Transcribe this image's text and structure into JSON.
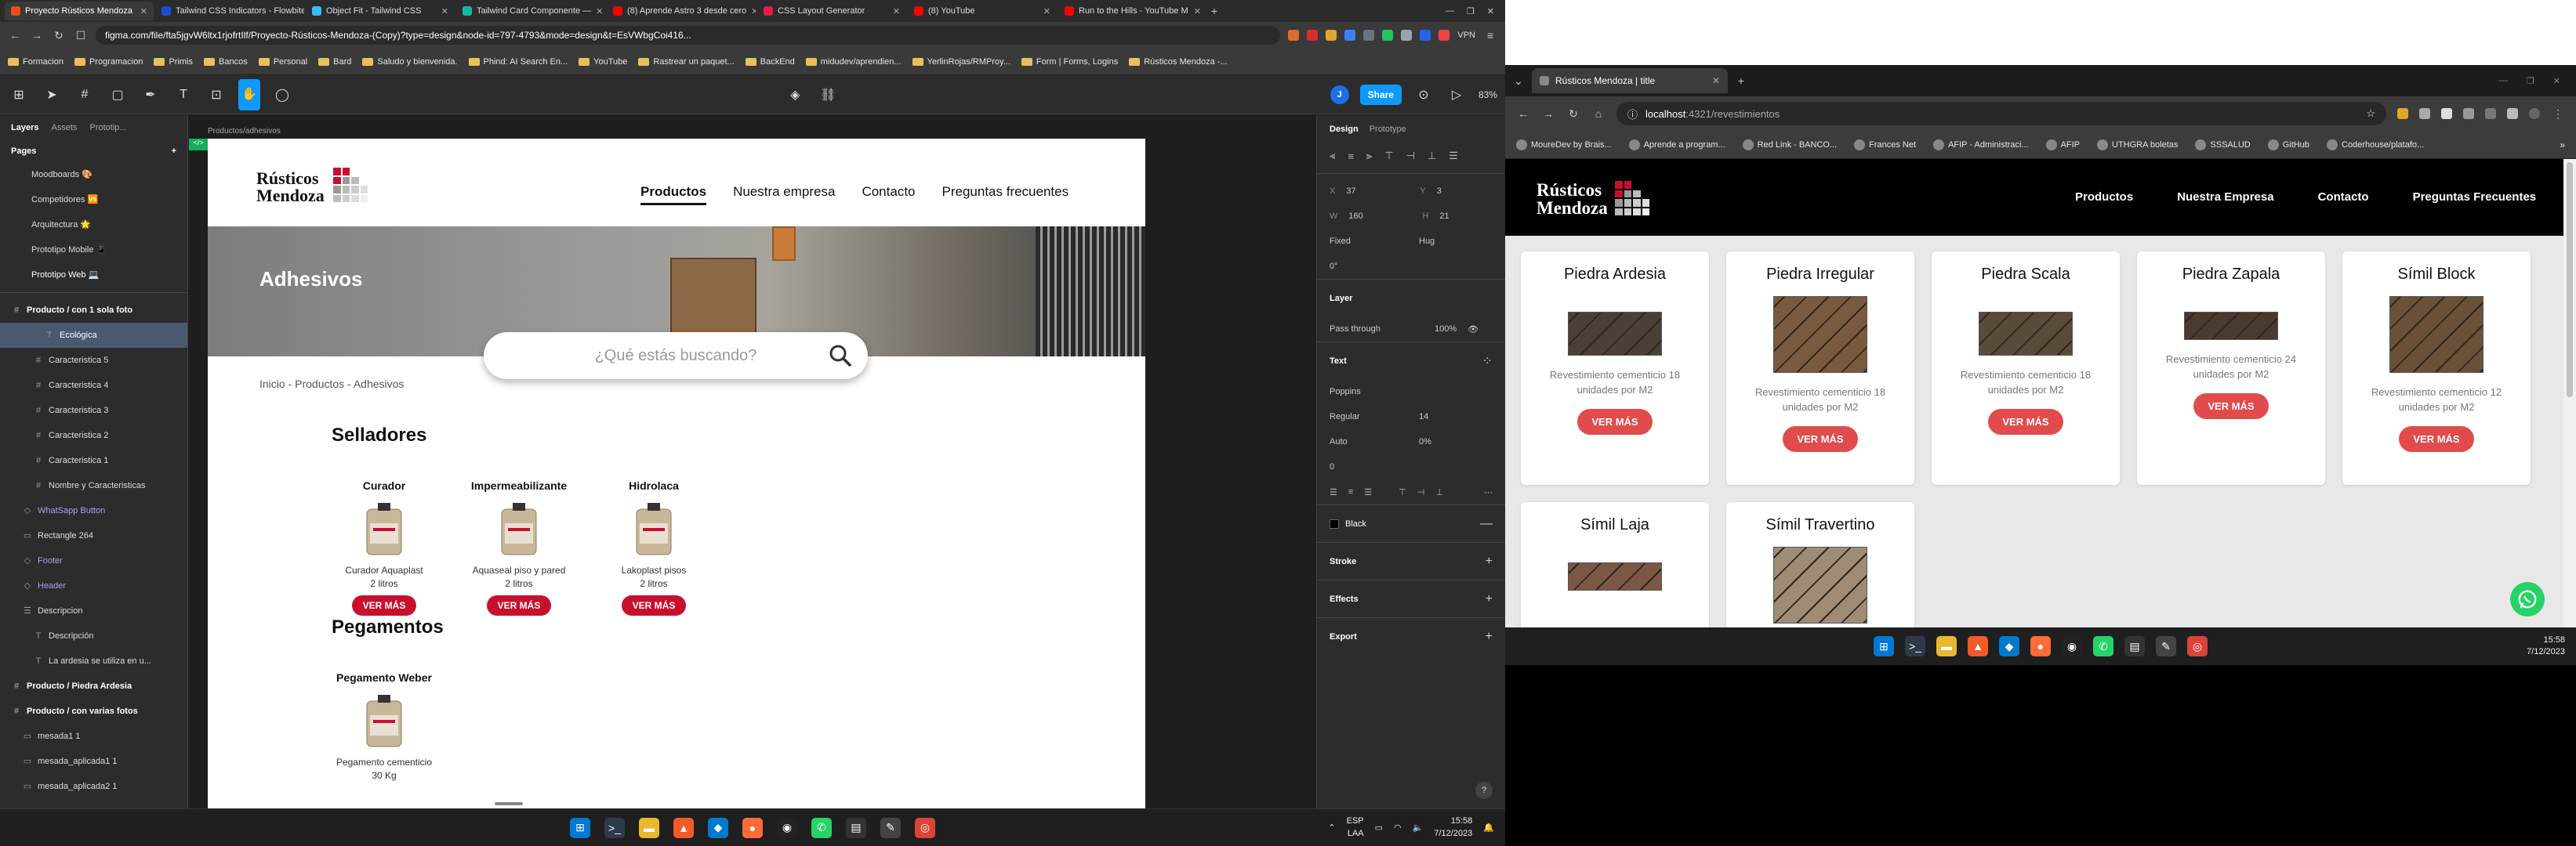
{
  "left": {
    "tabs": [
      {
        "label": "Proyecto Rústicos Mendoza",
        "color": "#e94e1b",
        "active": true
      },
      {
        "label": "Tailwind CSS Indicators - Flowbite",
        "color": "#1d4ed8"
      },
      {
        "label": "Object Fit - Tailwind CSS",
        "color": "#38bdf8"
      },
      {
        "label": "Tailwind Card Componente —",
        "color": "#14b8a6"
      },
      {
        "label": "(8) Aprende Astro 3 desde cero",
        "color": "#ff0000"
      },
      {
        "label": "CSS Layout Generator",
        "color": "#e11d48"
      },
      {
        "label": "(8) YouTube",
        "color": "#ff0000"
      },
      {
        "label": "Run to the Hills - YouTube M",
        "color": "#ff0000"
      }
    ],
    "url": "figma.com/file/fta5jgvW6ltx1rjofrtIlf/Proyecto-Rústicos-Mendoza-(Copy)?type=design&node-id=797-4793&mode=design&t=EsVWbgCoi416...",
    "vpn": "VPN",
    "bookmarks": [
      "Formacion",
      "Programacion",
      "Primis",
      "Bancos",
      "Personal",
      "Bard",
      "Saludo y bienvenida.",
      "Phind: AI Search En...",
      "YouTube",
      "Rastrear un paquet...",
      "BackEnd",
      "midudev/aprendien...",
      "YerlinRojas/RMProy...",
      "Form | Forms, Logins",
      "Rústicos Mendoza -..."
    ],
    "figma": {
      "zoom": "83%",
      "share": "Share",
      "avatar": "J",
      "panel_tabs": [
        "Layers",
        "Assets",
        "Prototip..."
      ],
      "pages_title": "Pages",
      "pages": [
        "Moodboards 🎨",
        "Competidores 🆚",
        "Arquitectura 🌟",
        "Prototipo Mobile 📱",
        "Prototipo Web 💻"
      ],
      "layers": [
        {
          "label": "Producto / con 1 sola foto",
          "indent": 0,
          "type": "frame",
          "bold": true
        },
        {
          "label": "Ecológica",
          "indent": 3,
          "type": "text",
          "sel": true
        },
        {
          "label": "Caracteristica 5",
          "indent": 2,
          "type": "frame"
        },
        {
          "label": "Caracteristica 4",
          "indent": 2,
          "type": "frame"
        },
        {
          "label": "Caracteristica 3",
          "indent": 2,
          "type": "frame"
        },
        {
          "label": "Caracteristica 2",
          "indent": 2,
          "type": "frame"
        },
        {
          "label": "Caracteristica 1",
          "indent": 2,
          "type": "frame"
        },
        {
          "label": "Nombre y Caracteristicas",
          "indent": 2,
          "type": "frame"
        },
        {
          "label": "WhatSapp Button",
          "indent": 1,
          "type": "comp"
        },
        {
          "label": "Rectangle 264",
          "indent": 1,
          "type": "rect"
        },
        {
          "label": "Footer",
          "indent": 1,
          "type": "comp"
        },
        {
          "label": "Header",
          "indent": 1,
          "type": "comp"
        },
        {
          "label": "Descripcion",
          "indent": 1,
          "type": "list"
        },
        {
          "label": "Descripción",
          "indent": 2,
          "type": "text"
        },
        {
          "label": "La ardesia se utiliza en u...",
          "indent": 2,
          "type": "text"
        },
        {
          "label": "Producto / Piedra Ardesia",
          "indent": 0,
          "type": "frame",
          "bold": true
        },
        {
          "label": "Producto / con varias fotos",
          "indent": 0,
          "type": "frame",
          "bold": true
        },
        {
          "label": "mesada1 1",
          "indent": 1,
          "type": "rect"
        },
        {
          "label": "mesada_aplicada1 1",
          "indent": 1,
          "type": "rect"
        },
        {
          "label": "mesada_aplicada2 1",
          "indent": 1,
          "type": "rect"
        }
      ],
      "frame_label": "Productos/adhesivos",
      "page": {
        "logo_line1": "Rústicos",
        "logo_line2": "Mendoza",
        "nav": [
          "Productos",
          "Nuestra empresa",
          "Contacto",
          "Preguntas frecuentes"
        ],
        "hero_title": "Adhesivos",
        "search_placeholder": "¿Qué estás buscando?",
        "breadcrumb": "Inicio - Productos - Adhesivos",
        "sections": [
          {
            "title": "Selladores",
            "products": [
              {
                "name": "Curador",
                "desc1": "Curador Aquaplast",
                "desc2": "2 litros",
                "btn": "VER MÁS"
              },
              {
                "name": "Impermeabilizante",
                "desc1": "Aquaseal piso y pared",
                "desc2": "2 litros",
                "btn": "VER MÁS"
              },
              {
                "name": "Hidrolaca",
                "desc1": "Lakoplast pisos",
                "desc2": "2 litros",
                "btn": "VER MÁS"
              }
            ]
          },
          {
            "title": "Pegamentos",
            "products": [
              {
                "name": "Pegamento Weber",
                "desc1": "Pegamento cementicio",
                "desc2": "30 Kg",
                "btn": ""
              }
            ]
          }
        ]
      },
      "right_panel": {
        "tabs": [
          "Design",
          "Prototype"
        ],
        "x": "37",
        "y": "3",
        "w": "160",
        "h": "21",
        "fixed": "Fixed",
        "hug": "Hug",
        "rotation": "0°",
        "layer_title": "Layer",
        "blend": "Pass through",
        "opacity": "100%",
        "text_title": "Text",
        "font": "Poppins",
        "weight": "Regular",
        "size": "14",
        "line_height": "Auto",
        "letter_spacing": "0%",
        "para": "0",
        "fill": "Black",
        "sections": [
          "Stroke",
          "Effects",
          "Export"
        ]
      }
    },
    "taskbar": {
      "lang1": "ESP",
      "lang2": "LAA",
      "time": "15:58",
      "date": "7/12/2023"
    }
  },
  "right": {
    "tab_title": "Rústicos Mendoza | title",
    "url_host": "localhost",
    "url_path": ":4321/revestimientos",
    "bookmarks": [
      "MoureDev by Brais...",
      "Aprende a program...",
      "Red Link - BANCO...",
      "Frances Net",
      "AFIP - Administraci...",
      "AFIP",
      "UTHGRA boletas",
      "SSSALUD",
      "GitHub",
      "Coderhouse/platafo..."
    ],
    "site": {
      "logo_line1": "Rústicos",
      "logo_line2": "Mendoza",
      "nav": [
        "Productos",
        "Nuestra Empresa",
        "Contacto",
        "Preguntas Frecuentes"
      ],
      "cards": [
        {
          "title": "Piedra Ardesia",
          "desc1": "Revestimiento cementicio 18",
          "desc2": "unidades por M2",
          "btn": "VER MÁS",
          "tone": "#4a4038",
          "shape": "wide"
        },
        {
          "title": "Piedra Irregular",
          "desc1": "Revestimiento cementicio 18",
          "desc2": "unidades por M2",
          "btn": "VER MÁS",
          "tone": "#7a5a3e",
          "shape": "square"
        },
        {
          "title": "Piedra Scala",
          "desc1": "Revestimiento cementicio 18",
          "desc2": "unidades por M2",
          "btn": "VER MÁS",
          "tone": "#5a4a3a",
          "shape": "wide"
        },
        {
          "title": "Piedra Zapala",
          "desc1": "Revestimiento cementicio 24",
          "desc2": "unidades por M2",
          "btn": "VER MÁS",
          "tone": "#4b3a2e",
          "shape": "slim"
        },
        {
          "title": "Símil Block",
          "desc1": "Revestimiento cementicio 12",
          "desc2": "unidades por M2",
          "btn": "VER MÁS",
          "tone": "#6b5038",
          "shape": "square"
        },
        {
          "title": "Símil Laja",
          "desc1": "",
          "desc2": "",
          "btn": "",
          "tone": "#7a5844",
          "shape": "slim"
        },
        {
          "title": "Símil Travertino",
          "desc1": "",
          "desc2": "",
          "btn": "",
          "tone": "#a08c74",
          "shape": "square"
        }
      ]
    },
    "taskbar": {
      "time": "15:58",
      "date": "7/12/2023"
    }
  },
  "colors": {
    "accent": "#0d99ff",
    "brand_red": "#c8102e",
    "card_btn": "#e14b4b"
  }
}
